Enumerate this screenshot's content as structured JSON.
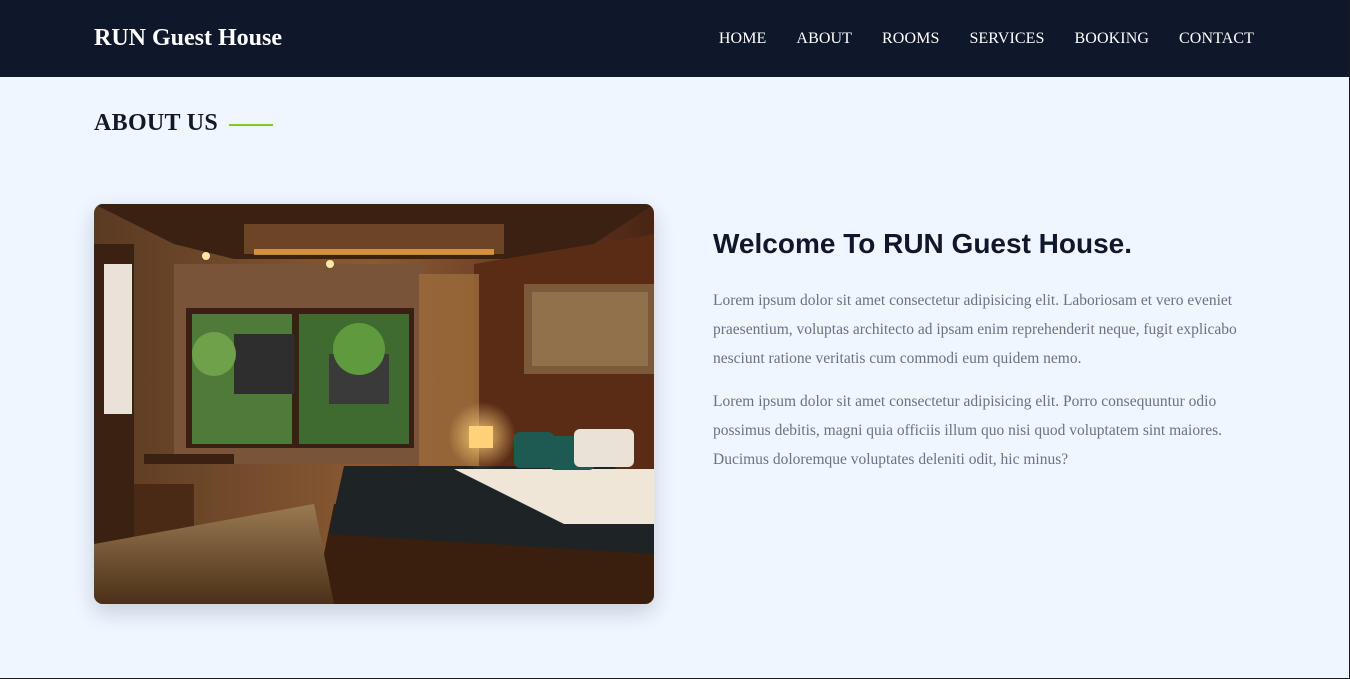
{
  "header": {
    "brand": "RUN Guest House",
    "nav": [
      "HOME",
      "ABOUT",
      "ROOMS",
      "SERVICES",
      "BOOKING",
      "CONTACT"
    ]
  },
  "about": {
    "section_title": "ABOUT US",
    "heading": "Welcome To RUN Guest House.",
    "paragraphs": [
      "Lorem ipsum dolor sit amet consectetur adipisicing elit. Laboriosam et vero eveniet praesentium, voluptas architecto ad ipsam enim reprehenderit neque, fugit explicabo nesciunt ratione veritatis cum commodi eum quidem nemo.",
      "Lorem ipsum dolor sit amet consectetur adipisicing elit. Porro consequuntur odio possimus debitis, magni quia officiis illum quo nisi quod voluptatem sint maiores. Ducimus doloremque voluptates deleniti odit, hic minus?"
    ]
  },
  "colors": {
    "header_bg": "#0f172a",
    "page_bg": "#eff6ff",
    "accent": "#84cc16",
    "heading": "#0f172a",
    "body_text": "#6b7280"
  }
}
